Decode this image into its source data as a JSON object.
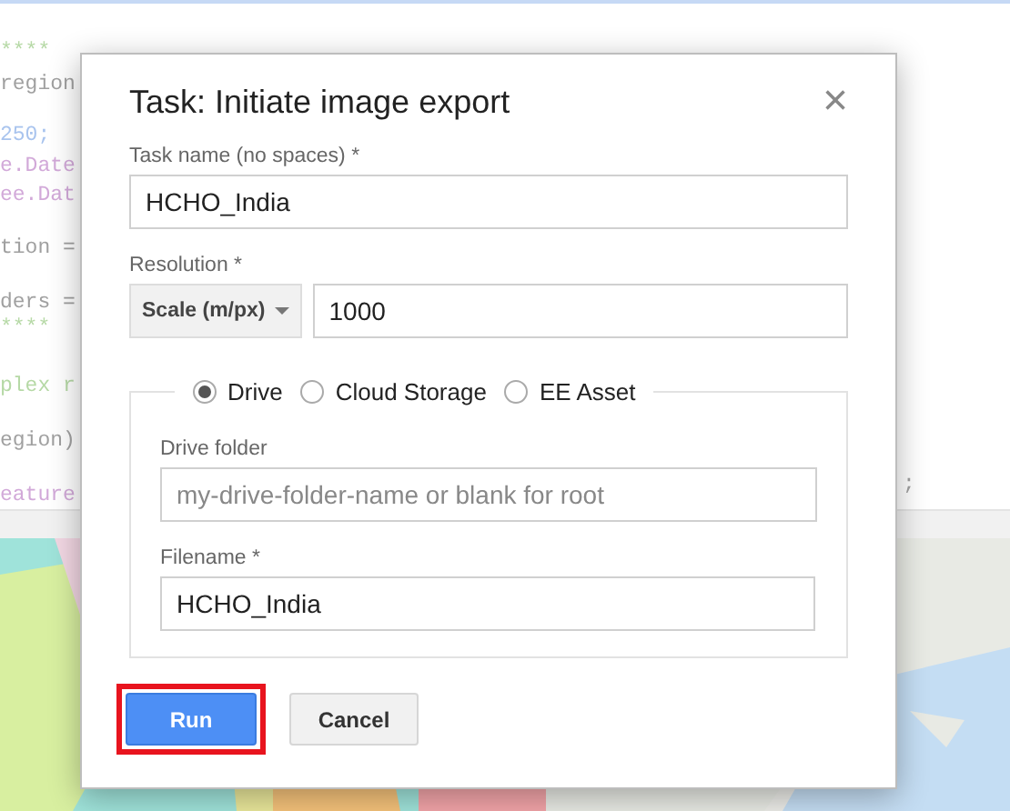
{
  "editor": {
    "code_lines": [
      {
        "text": "****",
        "kind": "comment"
      },
      {
        "text": "region",
        "kind": "code"
      },
      {
        "text": "250;",
        "kind": "number"
      },
      {
        "text": "e.Date",
        "kind": "keyword"
      },
      {
        "text": "ee.Dat",
        "kind": "keyword"
      },
      {
        "text": "tion =",
        "kind": "code"
      },
      {
        "text": "ders =",
        "kind": "code"
      },
      {
        "text": "****",
        "kind": "comment"
      },
      {
        "text": "plex r",
        "kind": "comment"
      },
      {
        "text": "egion)",
        "kind": "code"
      },
      {
        "text": "eature",
        "kind": "keyword"
      }
    ],
    "right_fragment": ";"
  },
  "dialog": {
    "title": "Task: Initiate image export",
    "close": "×",
    "task_name": {
      "label": "Task name (no spaces) *",
      "value": "HCHO_India"
    },
    "resolution": {
      "label": "Resolution *",
      "mode": "Scale (m/px)",
      "value": "1000"
    },
    "destinations": [
      {
        "label": "Drive",
        "selected": true
      },
      {
        "label": "Cloud Storage",
        "selected": false
      },
      {
        "label": "EE Asset",
        "selected": false
      }
    ],
    "drive_folder": {
      "label": "Drive folder",
      "placeholder": "my-drive-folder-name or blank for root"
    },
    "filename": {
      "label": "Filename *",
      "value": "HCHO_India"
    },
    "buttons": [
      {
        "label": "Run",
        "kind": "primary",
        "highlighted": true
      },
      {
        "label": "Cancel",
        "kind": "secondary",
        "highlighted": false
      }
    ]
  }
}
